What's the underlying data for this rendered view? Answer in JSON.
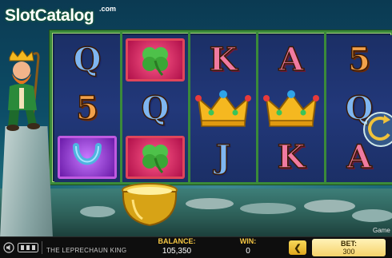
{
  "watermark": {
    "part1": "Slot",
    "part2": "Catalog",
    "suffix": ".com"
  },
  "game": {
    "title": "THE LEPRECHAUN KING",
    "side_tag": "Game"
  },
  "reels": [
    [
      "Q",
      "5",
      "horseshoe"
    ],
    [
      "clover",
      "Q",
      "clover"
    ],
    [
      "K",
      "crown",
      "J"
    ],
    [
      "A",
      "crown",
      "K"
    ],
    [
      "5",
      "Q",
      "A"
    ]
  ],
  "letter_colors": {
    "Q": "blue",
    "5": "orange",
    "K": "pink",
    "A": "pink",
    "J": "blue"
  },
  "status": {
    "balance_label": "BALANCE:",
    "balance_value": "105,350",
    "win_label": "WIN:",
    "win_value": "0",
    "bet_label": "BET:",
    "bet_value": "300",
    "back_glyph": "❮"
  },
  "colors": {
    "frame": "#3a8a3a",
    "label_gold": "#f6c844",
    "bar": "#0e0e0e"
  },
  "icons": [
    "sound-icon",
    "settings-icon",
    "clover-symbol",
    "horseshoe-symbol",
    "crown-symbol",
    "pot-of-gold",
    "spin-button-icon"
  ]
}
